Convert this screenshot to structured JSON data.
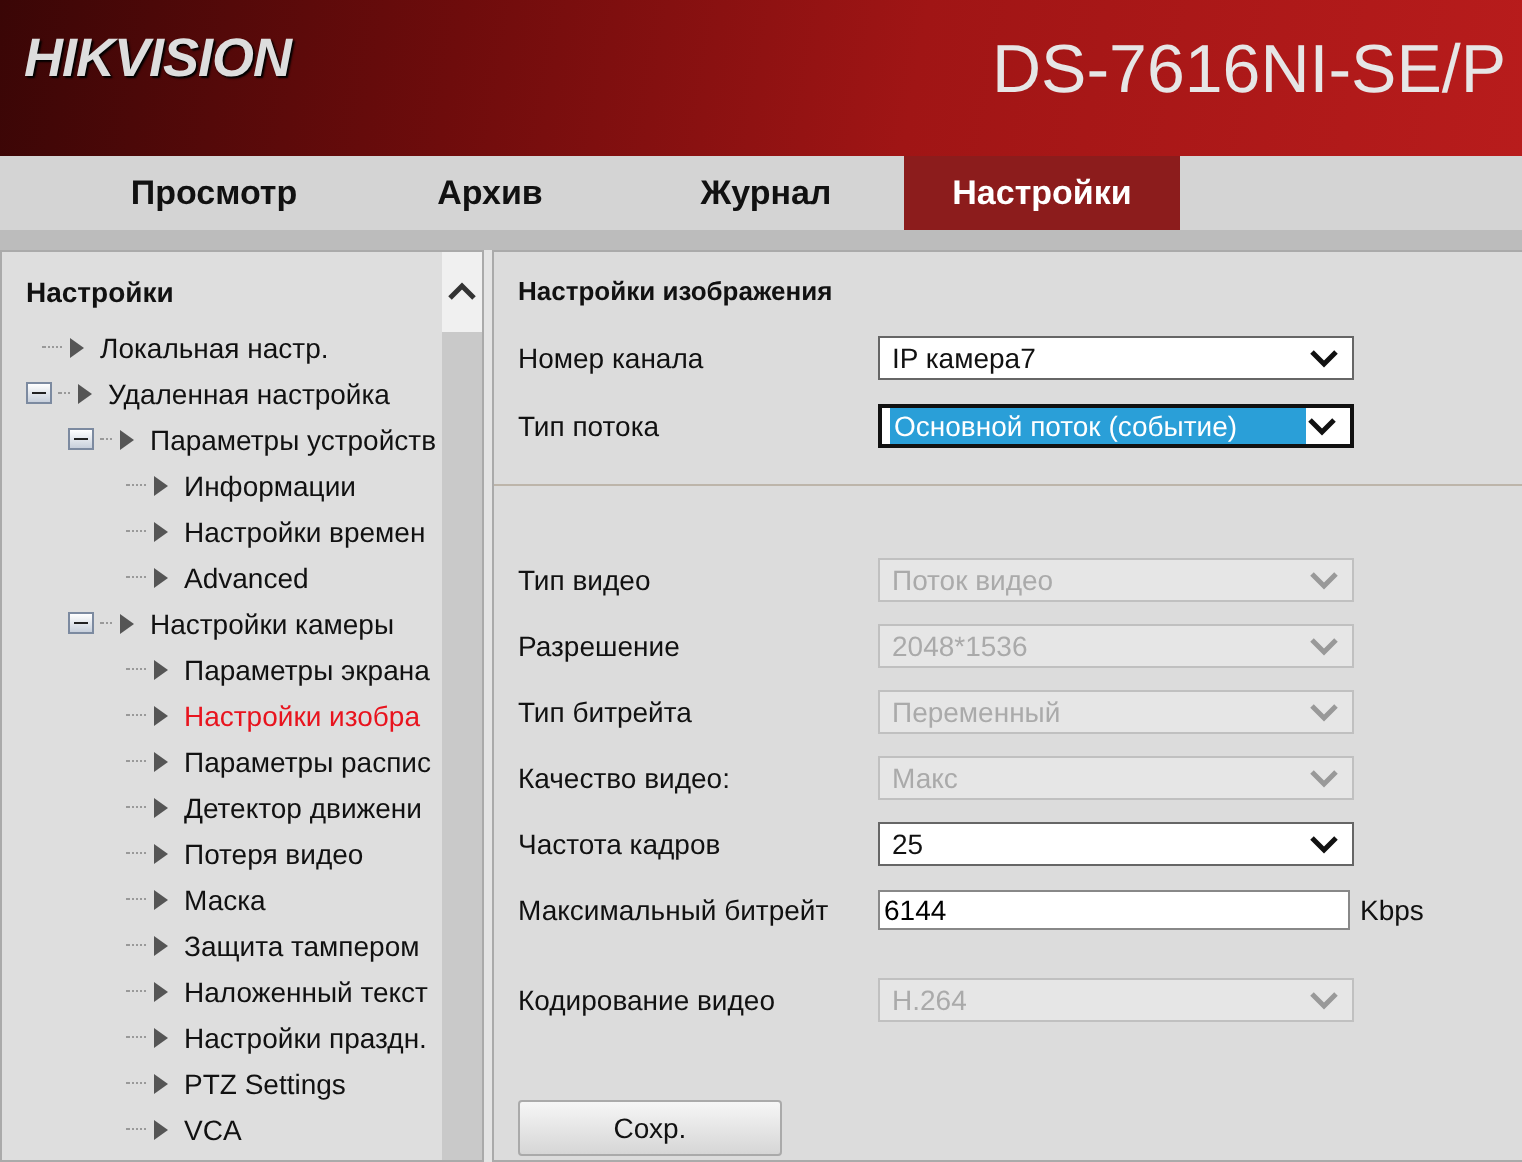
{
  "header": {
    "logo": "HIKVISION",
    "model": "DS-7616NI-SE/P"
  },
  "tabs": [
    {
      "label": "Просмотр",
      "selected": false
    },
    {
      "label": "Архив",
      "selected": false
    },
    {
      "label": "Журнал",
      "selected": false
    },
    {
      "label": "Настройки",
      "selected": true
    }
  ],
  "sidebar": {
    "title": "Настройки",
    "tree": [
      {
        "label": "Локальная настр.",
        "selected": false
      },
      {
        "label": "Удаленная настройка",
        "selected": false,
        "expanded": true,
        "children": [
          {
            "label": "Параметры устройств",
            "selected": false,
            "expanded": true,
            "children": [
              {
                "label": "Информации",
                "selected": false
              },
              {
                "label": "Настройки времен",
                "selected": false
              },
              {
                "label": "Advanced",
                "selected": false
              }
            ]
          },
          {
            "label": "Настройки камеры",
            "selected": false,
            "expanded": true,
            "children": [
              {
                "label": "Параметры экрана",
                "selected": false
              },
              {
                "label": "Настройки изобра",
                "selected": true
              },
              {
                "label": "Параметры распис",
                "selected": false
              },
              {
                "label": "Детектор движени",
                "selected": false
              },
              {
                "label": "Потеря видео",
                "selected": false
              },
              {
                "label": "Маска",
                "selected": false
              },
              {
                "label": "Защита тампером",
                "selected": false
              },
              {
                "label": "Наложенный текст",
                "selected": false
              },
              {
                "label": "Настройки праздн.",
                "selected": false
              },
              {
                "label": "PTZ Settings",
                "selected": false
              },
              {
                "label": "VCA",
                "selected": false
              }
            ]
          }
        ]
      }
    ]
  },
  "panel": {
    "title": "Настройки изображения",
    "top_fields": [
      {
        "label": "Номер канала",
        "kind": "select",
        "value": "IP камера7",
        "disabled": false,
        "focused": false
      },
      {
        "label": "Тип потока",
        "kind": "select",
        "value": "Основной поток (событие)",
        "disabled": false,
        "focused": true
      }
    ],
    "fields": [
      {
        "label": "Тип видео",
        "kind": "select",
        "value": "Поток видео",
        "disabled": true
      },
      {
        "label": "Разрешение",
        "kind": "select",
        "value": "2048*1536",
        "disabled": true
      },
      {
        "label": "Тип битрейта",
        "kind": "select",
        "value": "Переменный",
        "disabled": true
      },
      {
        "label": "Качество видео:",
        "kind": "select",
        "value": "Макс",
        "disabled": true
      },
      {
        "label": "Частота кадров",
        "kind": "select",
        "value": "25",
        "disabled": false
      },
      {
        "label": "Максимальный битрейт",
        "kind": "input",
        "value": "6144",
        "unit": "Kbps",
        "disabled": false
      },
      {
        "label": "Кодирование видео",
        "kind": "select",
        "value": "H.264",
        "disabled": true
      }
    ],
    "save_button": "Сохр."
  }
}
